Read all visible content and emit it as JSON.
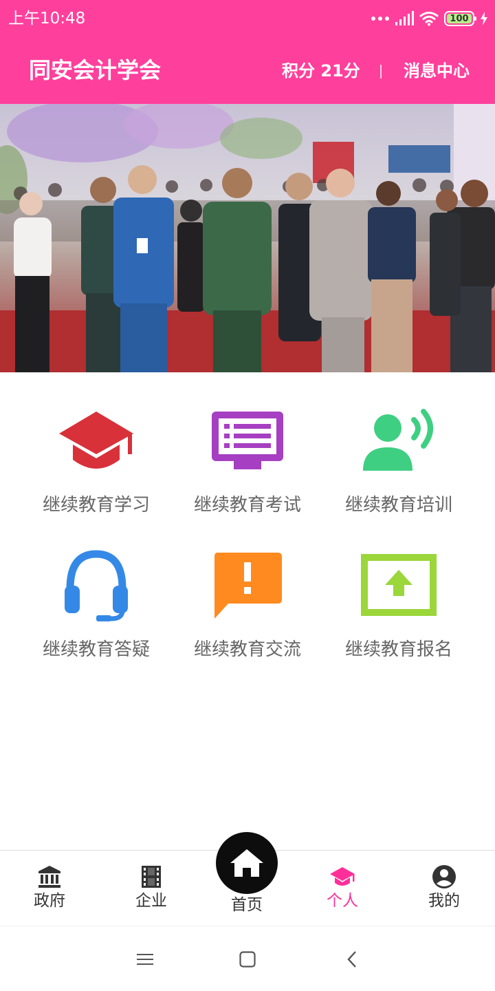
{
  "status_bar": {
    "time": "上午10:48",
    "battery": "100",
    "icons": [
      "signal-dots-icon",
      "cellular-signal-icon",
      "wifi-icon",
      "battery-icon",
      "charging-icon"
    ]
  },
  "header": {
    "title": "同安会计学会",
    "points": "积分 21分",
    "separator": "|",
    "messages": "消息中心",
    "background": "#ff3f9c"
  },
  "banner": {
    "image": "crowd-walking-photo",
    "pager_count": 4,
    "active_index": 1
  },
  "menu": {
    "items": [
      {
        "label": "继续教育学习",
        "icon": "graduation-cap-icon",
        "color": "#d8313a"
      },
      {
        "label": "继续教育考试",
        "icon": "monitor-list-icon",
        "color": "#a63fc1"
      },
      {
        "label": "继续教育培训",
        "icon": "speaker-voice-icon",
        "color": "#3fcf82"
      },
      {
        "label": "继续教育答疑",
        "icon": "headset-icon",
        "color": "#3489e6"
      },
      {
        "label": "继续教育交流",
        "icon": "chat-alert-icon",
        "color": "#ff8a1f"
      },
      {
        "label": "继续教育报名",
        "icon": "upload-screen-icon",
        "color": "#9bd63a"
      }
    ]
  },
  "bottom_nav": {
    "items": [
      {
        "label": "政府",
        "icon": "bank-icon"
      },
      {
        "label": "企业",
        "icon": "film-icon"
      },
      {
        "label": "首页",
        "icon": "home-icon"
      },
      {
        "label": "个人",
        "icon": "graduation-cap-icon"
      },
      {
        "label": "我的",
        "icon": "account-circle-icon"
      }
    ],
    "active": "个人",
    "active_color": "#ff2f9a"
  },
  "system_nav": {
    "icons": [
      "menu-icon",
      "home-square-icon",
      "back-icon"
    ]
  }
}
